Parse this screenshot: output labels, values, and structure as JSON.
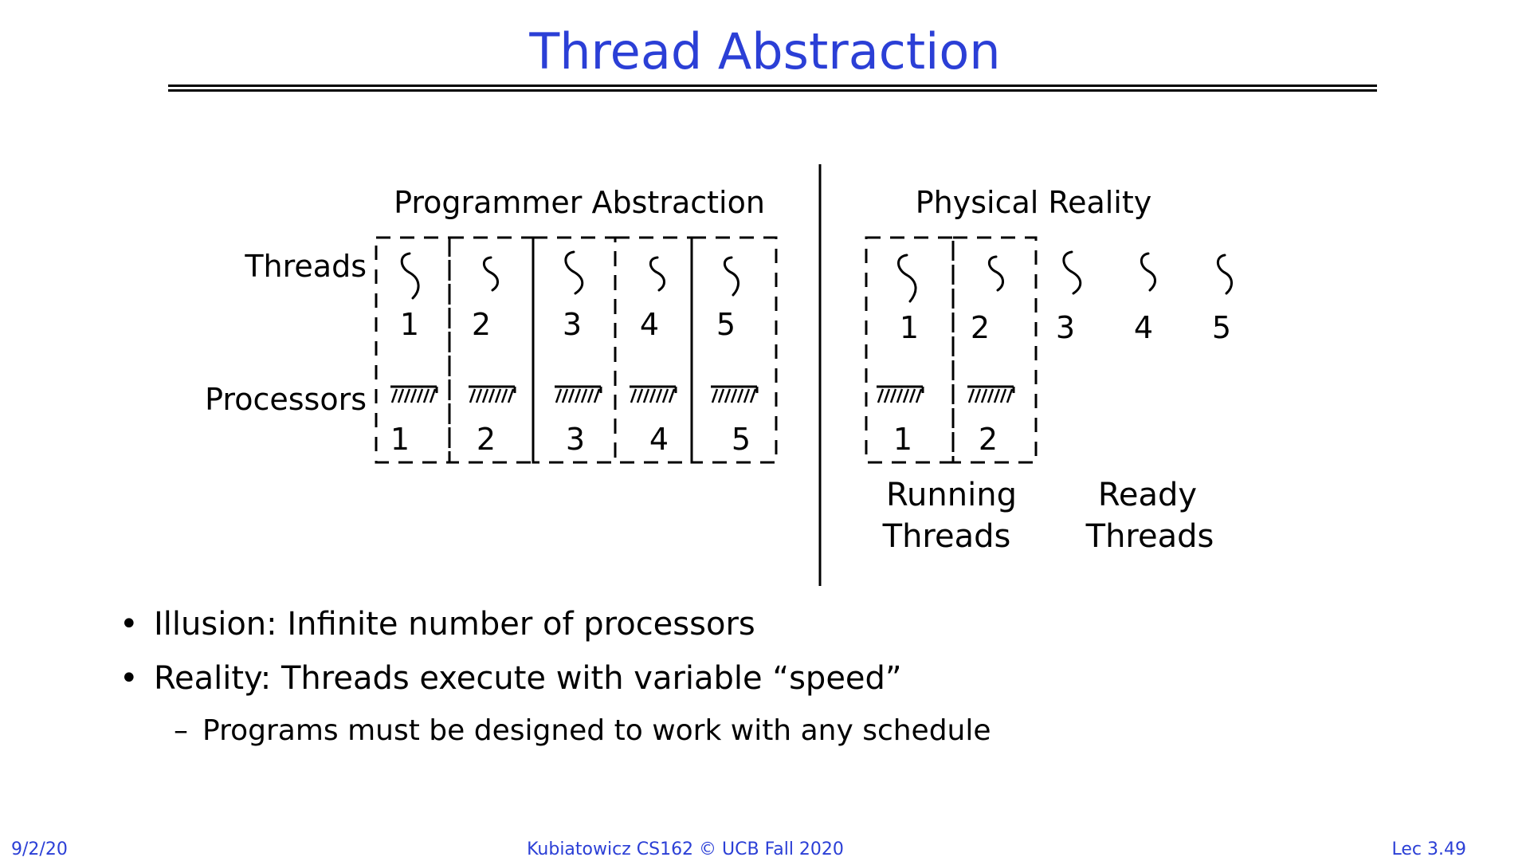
{
  "slide": {
    "title": "Thread Abstraction",
    "footer": {
      "date": "9/2/20",
      "course": "Kubiatowicz CS162 © UCB Fall 2020",
      "lecture": "Lec 3.49"
    }
  },
  "diagram": {
    "left_heading": "Programmer Abstraction",
    "right_heading": "Physical Reality",
    "row_label_threads": "Threads",
    "row_label_processors": "Processors",
    "abstraction_threads": [
      "1",
      "2",
      "3",
      "4",
      "5"
    ],
    "abstraction_processors": [
      "1",
      "2",
      "3",
      "4",
      "5"
    ],
    "reality_threads": [
      "1",
      "2",
      "3",
      "4",
      "5"
    ],
    "reality_processors": [
      "1",
      "2"
    ],
    "running_label": [
      "Running",
      "Threads"
    ],
    "ready_label": [
      "Ready",
      "Threads"
    ]
  },
  "bullets": [
    {
      "bullet": "•",
      "text": "Illusion: Infinite number of processors"
    },
    {
      "bullet": "•",
      "text": "Reality: Threads execute with variable “speed”"
    }
  ],
  "sub_bullets": [
    {
      "bullet": "–",
      "text": "Programs must be designed to work with any schedule"
    }
  ]
}
